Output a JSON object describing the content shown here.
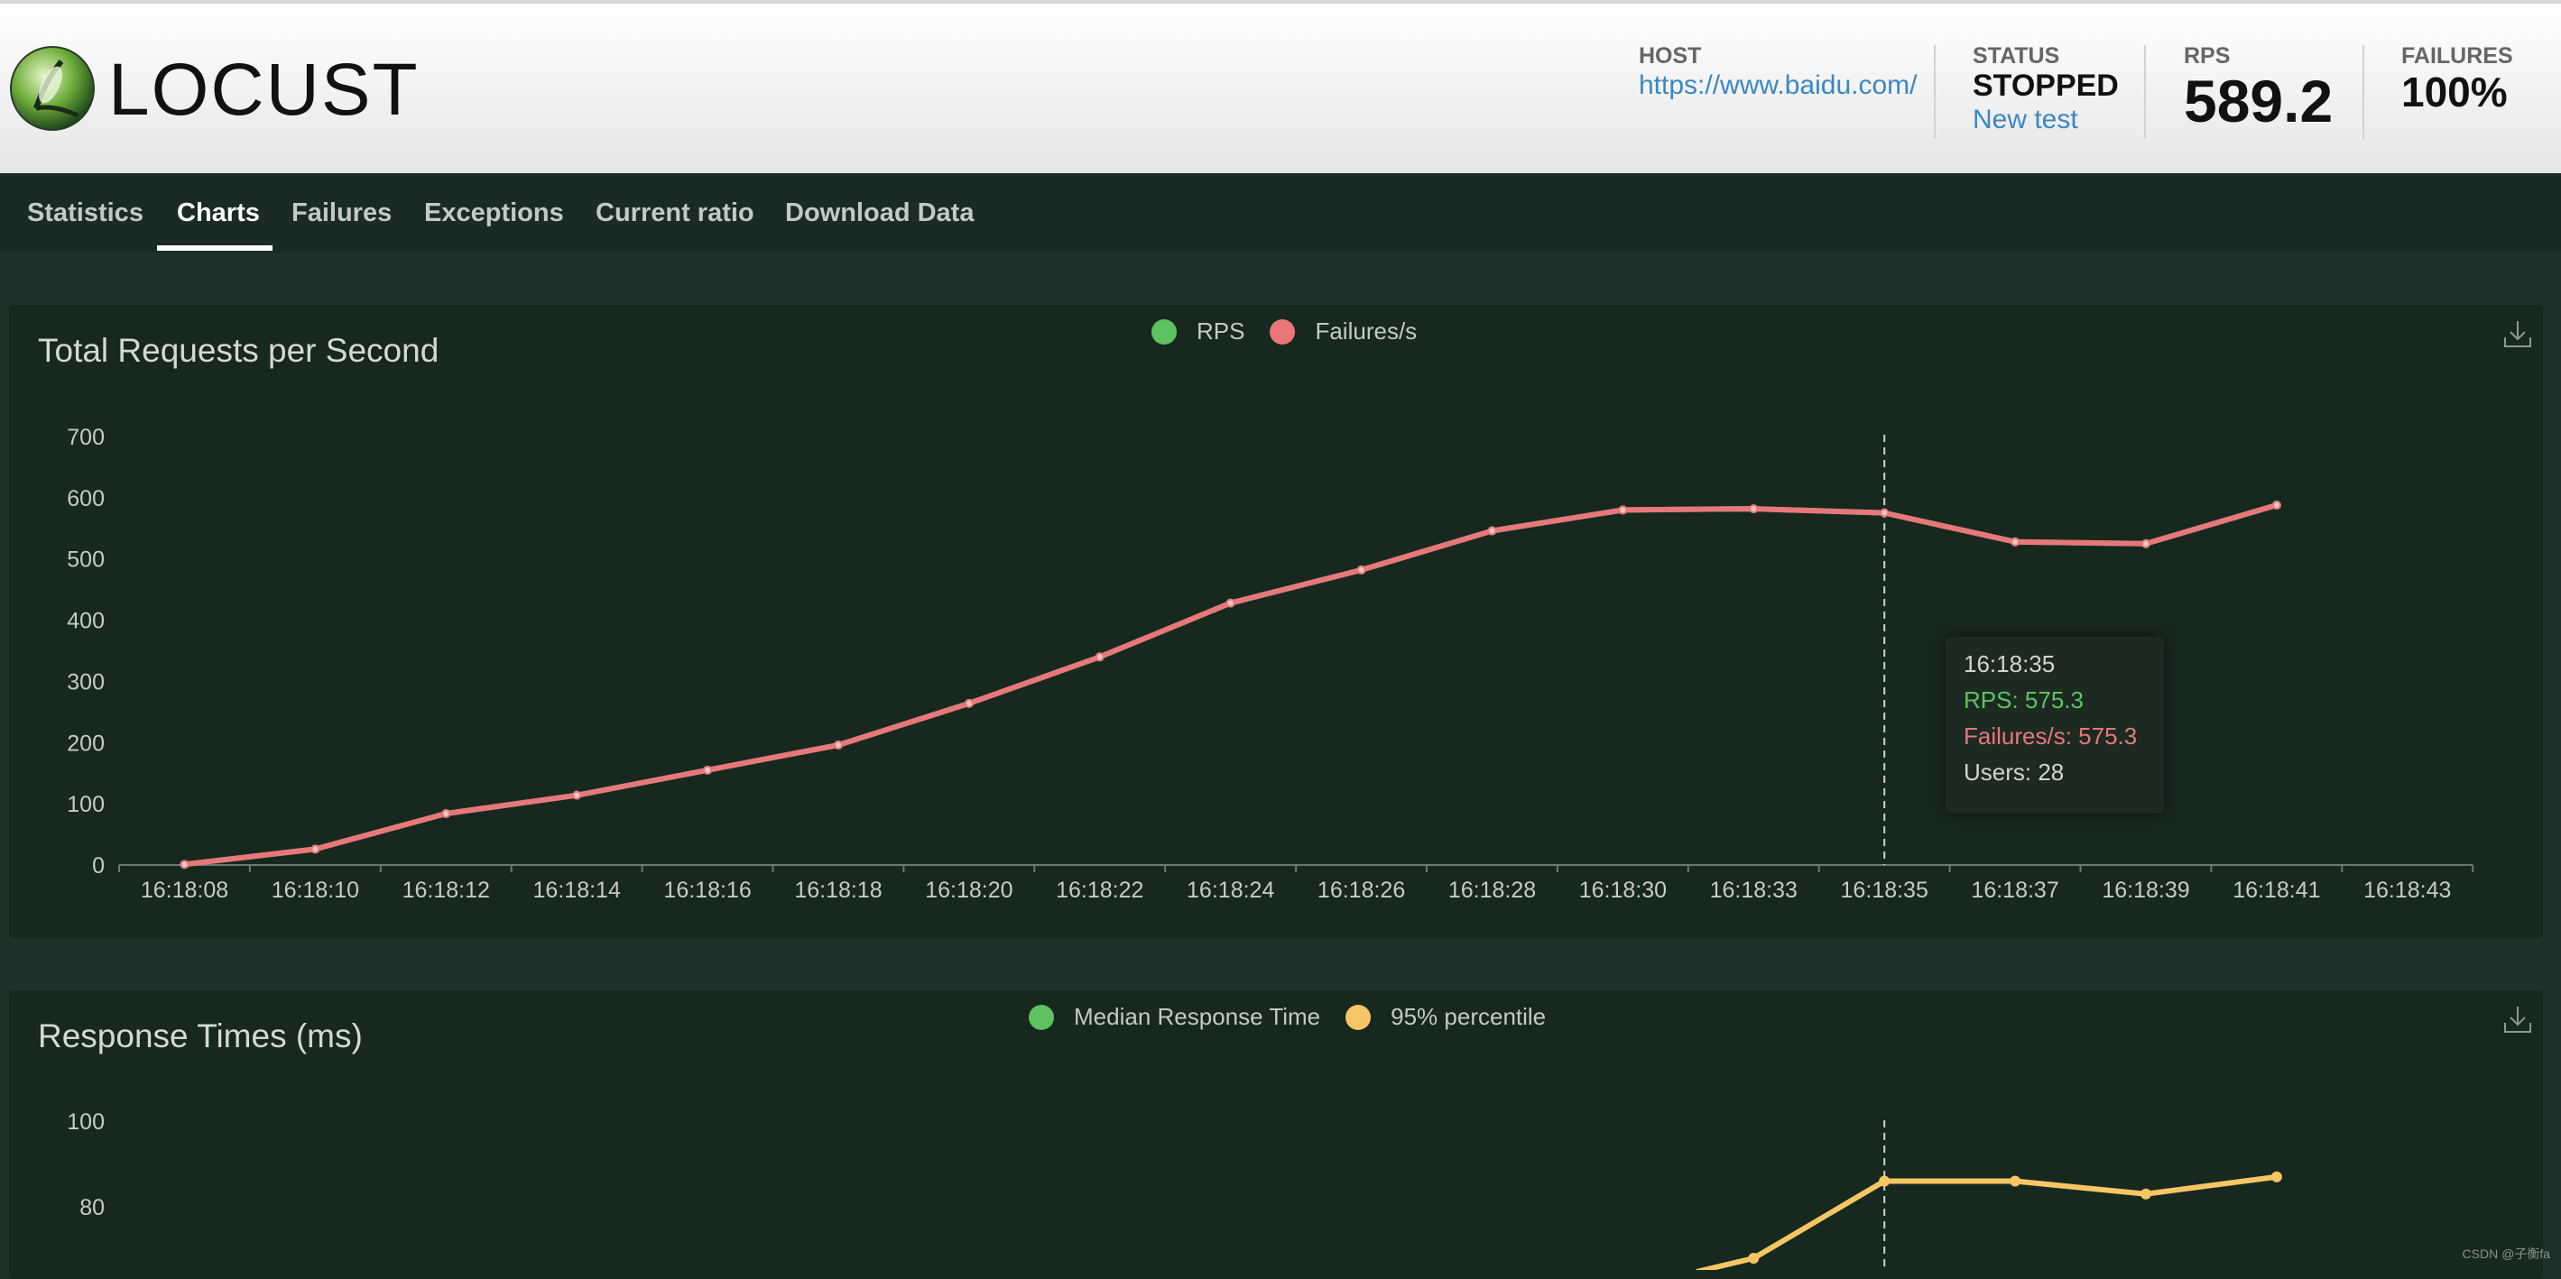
{
  "header": {
    "brand": "LOCUST",
    "host": {
      "label": "HOST",
      "value": "https://www.baidu.com/"
    },
    "status": {
      "label": "STATUS",
      "value": "STOPPED",
      "action": "New test"
    },
    "rps": {
      "label": "RPS",
      "value": "589.2"
    },
    "failures": {
      "label": "FAILURES",
      "value": "100%"
    }
  },
  "nav": {
    "tabs": [
      {
        "label": "Statistics",
        "active": false
      },
      {
        "label": "Charts",
        "active": true
      },
      {
        "label": "Failures",
        "active": false
      },
      {
        "label": "Exceptions",
        "active": false
      },
      {
        "label": "Current ratio",
        "active": false
      },
      {
        "label": "Download Data",
        "active": false
      }
    ]
  },
  "chart_data": [
    {
      "type": "line",
      "title": "Total Requests per Second",
      "legend": {
        "placement": "top-center"
      },
      "x": [
        "16:18:08",
        "16:18:10",
        "16:18:12",
        "16:18:14",
        "16:18:16",
        "16:18:18",
        "16:18:20",
        "16:18:22",
        "16:18:24",
        "16:18:26",
        "16:18:28",
        "16:18:30",
        "16:18:33",
        "16:18:35",
        "16:18:37",
        "16:18:39",
        "16:18:41",
        "16:18:43"
      ],
      "series": [
        {
          "name": "RPS",
          "color": "#5dc25f",
          "values": [
            1,
            26,
            84,
            114,
            155,
            196,
            264,
            340,
            428,
            482,
            546,
            580,
            582,
            575.3,
            528,
            525,
            588
          ]
        },
        {
          "name": "Failures/s",
          "color": "#e8777a",
          "values": [
            1,
            26,
            84,
            114,
            155,
            196,
            264,
            340,
            428,
            482,
            546,
            580,
            582,
            575.3,
            528,
            525,
            588
          ]
        }
      ],
      "yticks": [
        "0",
        "100",
        "200",
        "300",
        "400",
        "500",
        "600",
        "700"
      ],
      "ylim": [
        0,
        700
      ],
      "tooltip": {
        "time": "16:18:35",
        "rps": "RPS: 575.3",
        "failures": "Failures/s: 575.3",
        "users": "Users: 28"
      }
    },
    {
      "type": "line",
      "title": "Response Times (ms)",
      "legend": {
        "placement": "top-center"
      },
      "series": [
        {
          "name": "Median Response Time",
          "color": "#5dc25f"
        },
        {
          "name": "95% percentile",
          "color": "#f5c663",
          "values_partial": [
            {
              "x": "16:18:33",
              "y": 68
            },
            {
              "x": "16:18:35",
              "y": 86
            },
            {
              "x": "16:18:37",
              "y": 86
            },
            {
              "x": "16:18:39",
              "y": 83
            },
            {
              "x": "16:18:41",
              "y": 87
            }
          ]
        }
      ],
      "yticks": [
        "80",
        "100"
      ]
    }
  ],
  "footer": {
    "watermark": "CSDN @子衡fa"
  }
}
